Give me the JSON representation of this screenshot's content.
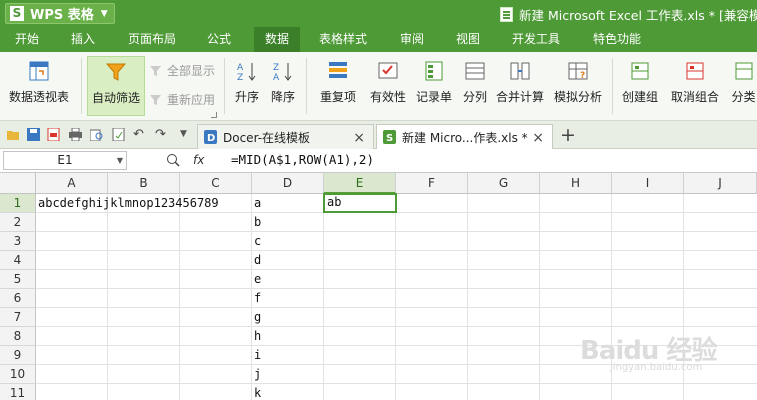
{
  "app": {
    "name": "WPS 表格",
    "logo_letter": "S",
    "window_title": "新建 Microsoft Excel 工作表.xls * [兼容模式]"
  },
  "menu": [
    "开始",
    "插入",
    "页面布局",
    "公式",
    "数据",
    "表格样式",
    "审阅",
    "视图",
    "开发工具",
    "特色功能"
  ],
  "active_menu": "数据",
  "ribbon": {
    "pivot": "数据透视表",
    "autofilter": "自动筛选",
    "show_all": "全部显示",
    "reapply": "重新应用",
    "sort_asc": "升序",
    "sort_desc": "降序",
    "duplicates": "重复项",
    "validity": "有效性",
    "record": "记录单",
    "split": "分列",
    "consolidate": "合并计算",
    "simulate": "模拟分析",
    "group": "创建组",
    "ungroup": "取消组合",
    "subtotal": "分类"
  },
  "tabs": [
    {
      "label": "Docer-在线模板",
      "close": "×"
    },
    {
      "label": "新建 Micro...作表.xls *",
      "close": "×"
    }
  ],
  "new_tab": "+",
  "formula_bar": {
    "name_box": "E1",
    "fx": "fx",
    "formula": "=MID(A$1,ROW(A1),2)"
  },
  "columns": [
    "A",
    "B",
    "C",
    "D",
    "E",
    "F",
    "G",
    "H",
    "I",
    "J"
  ],
  "rows": [
    "1",
    "2",
    "3",
    "4",
    "5",
    "6",
    "7",
    "8",
    "9",
    "10",
    "11"
  ],
  "cells": {
    "A1": "abcdefghijklmnop123456789",
    "E1": "ab",
    "D": [
      "a",
      "b",
      "c",
      "d",
      "e",
      "f",
      "g",
      "h",
      "i",
      "j",
      "k"
    ]
  },
  "selected": {
    "column": "E",
    "row": "1"
  },
  "watermark": {
    "main": "Baidu 经验",
    "sub": "jingyan.baidu.com"
  },
  "colors": {
    "accent": "#4e9a36",
    "ribbon_bg": "#f6f8f4",
    "selection": "#4e9a36"
  }
}
